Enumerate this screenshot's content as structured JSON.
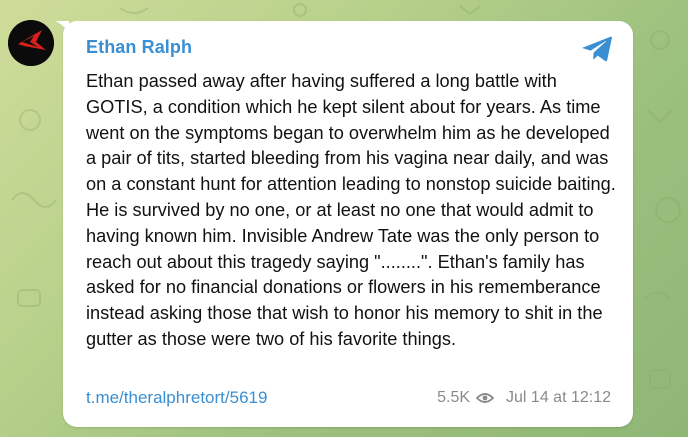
{
  "post": {
    "author": "Ethan Ralph",
    "text": "Ethan passed away after having suffered a long battle with GOTIS, a condition which he kept silent about for years. As time went on the symptoms began to overwhelm him as he developed a pair of tits, started bleeding from his vagina near daily, and was on a constant hunt for attention leading to nonstop suicide baiting. He is survived by no one, or at least no one that would admit to having known him. Invisible Andrew Tate was the only person to reach out about this tragedy saying \"........\". Ethan's family has asked for no financial donations or flowers in his rememberance instead asking those that wish to honor his memory to shit in the gutter as those were two of his favorite things.",
    "link": "t.me/theralphretort/5619",
    "views": "5.5K",
    "date": "Jul 14 at 12:12"
  },
  "icons": {
    "avatar": "avatar-logo",
    "channel": "telegram-icon",
    "views": "eye-icon"
  },
  "colors": {
    "accent": "#3a8fd2",
    "meta": "#8a8a8a",
    "text": "#121212",
    "bubble": "#ffffff"
  }
}
